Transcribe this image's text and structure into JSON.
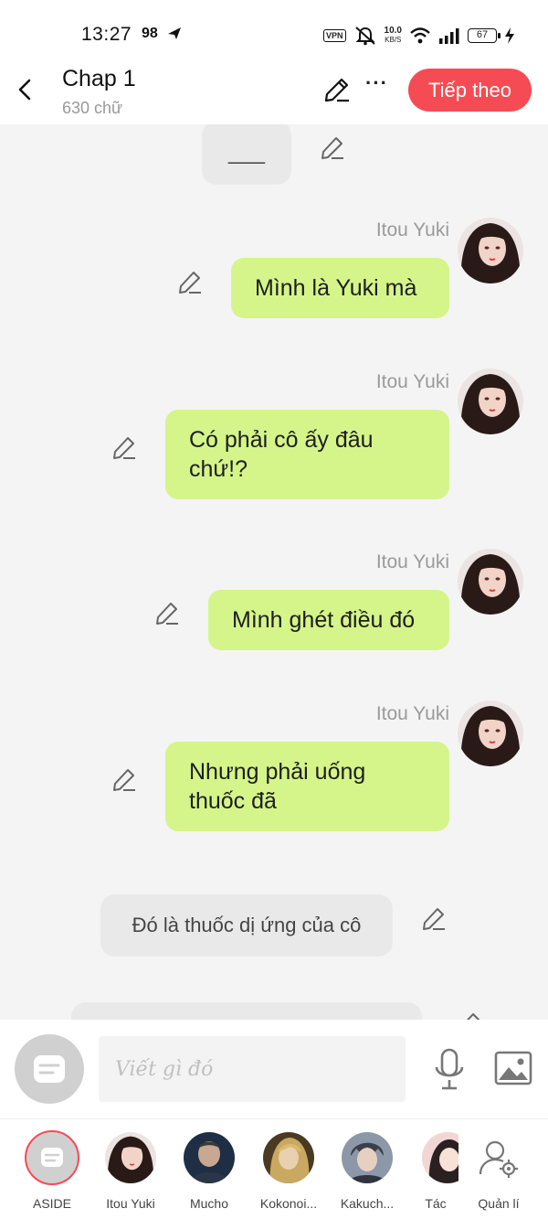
{
  "status_bar": {
    "time": "13:27",
    "badge": "98",
    "vpn": "VPN",
    "speed_value": "10.0",
    "speed_unit": "KB/S",
    "battery": "67"
  },
  "header": {
    "title": "Chap 1",
    "subtitle": "630 chữ",
    "next_label": "Tiếp theo"
  },
  "chat": {
    "top_partial_text": "___",
    "messages": [
      {
        "sender": "Itou Yuki",
        "text": "Mình là Yuki mà"
      },
      {
        "sender": "Itou Yuki",
        "text": "Có phải cô ấy đâu chứ!?"
      },
      {
        "sender": "Itou Yuki",
        "text": "Mình ghét điều đó"
      },
      {
        "sender": "Itou Yuki",
        "text": "Nhưng phải uống thuốc đã"
      }
    ],
    "narration": "Đó là thuốc dị ứng của cô"
  },
  "input": {
    "placeholder": "Viết gì đó"
  },
  "characters": [
    {
      "name": "ASIDE"
    },
    {
      "name": "Itou Yuki"
    },
    {
      "name": "Mucho"
    },
    {
      "name": "Kokonoi..."
    },
    {
      "name": "Kakuch..."
    },
    {
      "name": "Tác"
    },
    {
      "name": "Quản lí"
    }
  ],
  "colors": {
    "accent": "#f54b55",
    "bubble_green": "#d5f58a",
    "bubble_gray": "#e9e9e9",
    "background": "#f4f4f4"
  }
}
